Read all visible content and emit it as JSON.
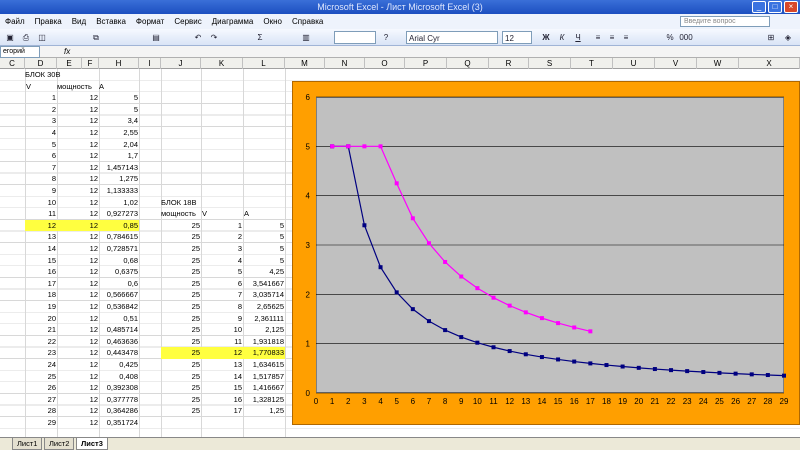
{
  "window": {
    "title": "Microsoft Excel - Лист Microsoft Excel (3)"
  },
  "menu": {
    "items": [
      "Файл",
      "Правка",
      "Вид",
      "Вставка",
      "Формат",
      "Сервис",
      "Диаграмма",
      "Окно",
      "Справка"
    ],
    "help_placeholder": "Введите вопрос"
  },
  "toolbar": {
    "font_name": "Arial Cyr",
    "font_size": "12",
    "bold": "Ж",
    "italic": "К",
    "underline": "Ч",
    "percent": "%",
    "thousands": "000",
    "sigma": "Σ"
  },
  "formula_bar": {
    "name_box": "егорий",
    "fx": "fx"
  },
  "columns": [
    "C",
    "D",
    "E",
    "F",
    "H",
    "I",
    "J",
    "K",
    "L",
    "M",
    "N",
    "O",
    "P",
    "Q",
    "R",
    "S",
    "T",
    "U",
    "V",
    "W",
    "X"
  ],
  "block30": {
    "title": "БЛОК 30В",
    "headers": [
      "V",
      "мощность",
      "A"
    ],
    "rows": [
      [
        "1",
        "12",
        "5"
      ],
      [
        "2",
        "12",
        "5"
      ],
      [
        "3",
        "12",
        "3,4"
      ],
      [
        "4",
        "12",
        "2,55"
      ],
      [
        "5",
        "12",
        "2,04"
      ],
      [
        "6",
        "12",
        "1,7"
      ],
      [
        "7",
        "12",
        "1,457143"
      ],
      [
        "8",
        "12",
        "1,275"
      ],
      [
        "9",
        "12",
        "1,133333"
      ],
      [
        "10",
        "12",
        "1,02"
      ],
      [
        "11",
        "12",
        "0,927273"
      ],
      [
        "12",
        "12",
        "0,85"
      ],
      [
        "13",
        "12",
        "0,784615"
      ],
      [
        "14",
        "12",
        "0,728571"
      ],
      [
        "15",
        "12",
        "0,68"
      ],
      [
        "16",
        "12",
        "0,6375"
      ],
      [
        "17",
        "12",
        "0,6"
      ],
      [
        "18",
        "12",
        "0,566667"
      ],
      [
        "19",
        "12",
        "0,536842"
      ],
      [
        "20",
        "12",
        "0,51"
      ],
      [
        "21",
        "12",
        "0,485714"
      ],
      [
        "22",
        "12",
        "0,463636"
      ],
      [
        "23",
        "12",
        "0,443478"
      ],
      [
        "24",
        "12",
        "0,425"
      ],
      [
        "25",
        "12",
        "0,408"
      ],
      [
        "26",
        "12",
        "0,392308"
      ],
      [
        "27",
        "12",
        "0,377778"
      ],
      [
        "28",
        "12",
        "0,364286"
      ],
      [
        "29",
        "12",
        "0,351724"
      ]
    ],
    "highlight_row": 11
  },
  "block18": {
    "title": "БЛОК 18В",
    "headers": [
      "мощность",
      "V",
      "A"
    ],
    "rows": [
      [
        "25",
        "1",
        "5"
      ],
      [
        "25",
        "2",
        "5"
      ],
      [
        "25",
        "3",
        "5"
      ],
      [
        "25",
        "4",
        "5"
      ],
      [
        "25",
        "5",
        "4,25"
      ],
      [
        "25",
        "6",
        "3,541667"
      ],
      [
        "25",
        "7",
        "3,035714"
      ],
      [
        "25",
        "8",
        "2,65625"
      ],
      [
        "25",
        "9",
        "2,361111"
      ],
      [
        "25",
        "10",
        "2,125"
      ],
      [
        "25",
        "11",
        "1,931818"
      ],
      [
        "25",
        "12",
        "1,770833"
      ],
      [
        "25",
        "13",
        "1,634615"
      ],
      [
        "25",
        "14",
        "1,517857"
      ],
      [
        "25",
        "15",
        "1,416667"
      ],
      [
        "25",
        "16",
        "1,328125"
      ],
      [
        "25",
        "17",
        "1,25"
      ]
    ],
    "highlight_row": 11
  },
  "chart_data": {
    "type": "line",
    "x": [
      1,
      2,
      3,
      4,
      5,
      6,
      7,
      8,
      9,
      10,
      11,
      12,
      13,
      14,
      15,
      16,
      17,
      18,
      19,
      20,
      21,
      22,
      23,
      24,
      25,
      26,
      27,
      28,
      29
    ],
    "ylim": [
      0,
      6
    ],
    "xlim": [
      0,
      29
    ],
    "grid": true,
    "background": "#c0c0c0",
    "frame_color": "#ff9f00",
    "series": [
      {
        "color": "#000080",
        "values": [
          5,
          5,
          3.4,
          2.55,
          2.04,
          1.7,
          1.457143,
          1.275,
          1.133333,
          1.02,
          0.927273,
          0.85,
          0.784615,
          0.728571,
          0.68,
          0.6375,
          0.6,
          0.566667,
          0.536842,
          0.51,
          0.485714,
          0.463636,
          0.443478,
          0.425,
          0.408,
          0.392308,
          0.377778,
          0.364286,
          0.351724
        ]
      },
      {
        "color": "#ff00ff",
        "values": [
          5,
          5,
          5,
          5,
          4.25,
          3.541667,
          3.035714,
          2.65625,
          2.361111,
          2.125,
          1.931818,
          1.770833,
          1.634615,
          1.517857,
          1.416667,
          1.328125,
          1.25
        ]
      }
    ],
    "x_ticks": [
      "0",
      "1",
      "2",
      "3",
      "4",
      "5",
      "6",
      "7",
      "8",
      "9",
      "10",
      "11",
      "12",
      "13",
      "14",
      "15",
      "16",
      "17",
      "18",
      "19",
      "20",
      "21",
      "22",
      "23",
      "24",
      "25",
      "26",
      "27",
      "28",
      "29"
    ],
    "y_ticks": [
      "0",
      "1",
      "2",
      "3",
      "4",
      "5",
      "6"
    ]
  },
  "sheets": {
    "tabs": [
      "Лист1",
      "Лист2",
      "Лист3"
    ],
    "active": 2
  }
}
